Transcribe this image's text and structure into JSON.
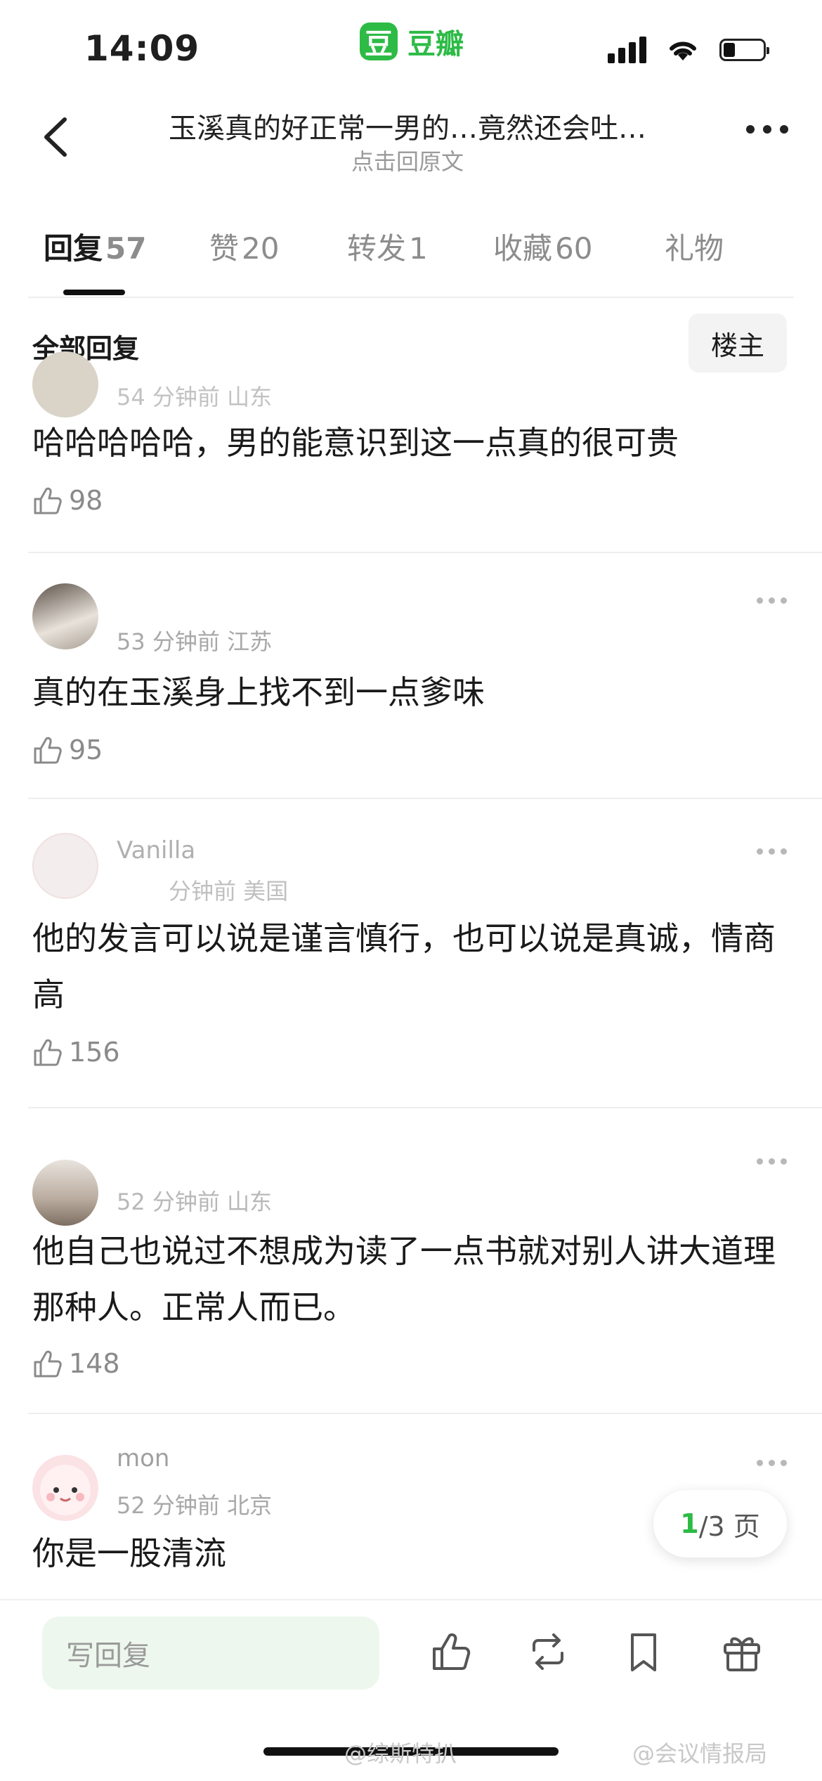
{
  "status_bar": {
    "time": "14:09",
    "app_logo_text": "豆",
    "app_name": "豆瓣",
    "icons": [
      "signal-icon",
      "wifi-icon",
      "battery-icon"
    ],
    "battery_level": 0.3
  },
  "header": {
    "title": "玉溪真的好正常一男的…竟然还会吐…",
    "subtitle": "点击回原文"
  },
  "tabs": [
    {
      "label": "回复",
      "count": "57",
      "active": true
    },
    {
      "label": "赞",
      "count": "20"
    },
    {
      "label": "转发",
      "count": "1"
    },
    {
      "label": "收藏",
      "count": "60"
    },
    {
      "label": "礼物",
      "count": ""
    }
  ],
  "section": {
    "label": "全部回复",
    "filter_button": "楼主"
  },
  "comments": [
    {
      "meta": "54 分钟前 山东",
      "text": "哈哈哈哈哈，男的能意识到这一点真的很可贵",
      "likes": "98"
    },
    {
      "meta": "53 分钟前 江苏",
      "text": "真的在玉溪身上找不到一点爹味",
      "likes": "95"
    },
    {
      "username": "Vanilla",
      "meta": "分钟前 美国",
      "text": "他的发言可以说是谨言慎行，也可以说是真诚，情商高",
      "likes": "156"
    },
    {
      "meta": "52 分钟前 山东",
      "text": "他自己也说过不想成为读了一点书就对别人讲大道理那种人。正常人而已。",
      "likes": "148"
    },
    {
      "username": "mon",
      "meta": "52 分钟前 北京",
      "text": "你是一股清流",
      "likes": ""
    }
  ],
  "pagination": {
    "current": "1",
    "total_label": "/3 页"
  },
  "bottom_bar": {
    "reply_placeholder": "写回复",
    "actions": [
      "like-icon",
      "repost-icon",
      "bookmark-icon",
      "gift-icon"
    ]
  },
  "watermarks": {
    "left": "@综斯特扒",
    "right": "@会议情报局"
  },
  "colors": {
    "brand_green": "#2dbb46",
    "text_primary": "#1a1a1a",
    "text_secondary": "#8a8a8a"
  }
}
